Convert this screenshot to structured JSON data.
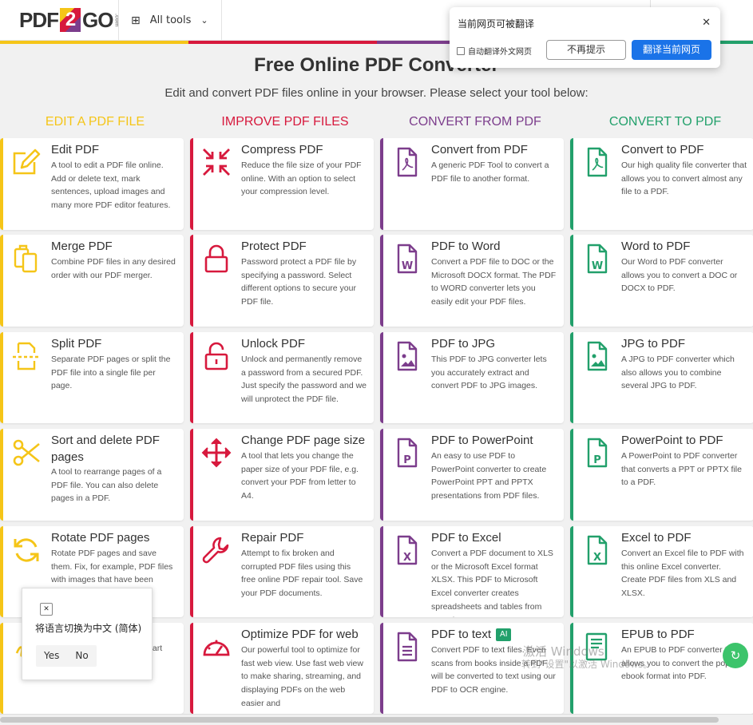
{
  "header": {
    "logo": {
      "pdf": "PDF",
      "two": "2",
      "go": "GO",
      "com": ".com"
    },
    "all_tools_label": "All tools"
  },
  "colors": {
    "edit": "#f5c518",
    "improve": "#d7193d",
    "convert_from": "#7c3d8c",
    "convert_to": "#22a06b"
  },
  "hero": {
    "title": "Free Online PDF Converter",
    "subtitle": "Edit and convert PDF files online in your browser. Please select your tool below:"
  },
  "columns": [
    {
      "heading": "EDIT A PDF FILE",
      "color": "#f5c518",
      "cards": [
        {
          "title": "Edit PDF",
          "icon": "pencil-square-icon",
          "desc": "A tool to edit a PDF file online. Add or delete text, mark sentences, upload images and many more PDF editor features."
        },
        {
          "title": "Merge PDF",
          "icon": "merge-documents-icon",
          "desc": "Combine PDF files in any desired order with our PDF merger."
        },
        {
          "title": "Split PDF",
          "icon": "split-page-icon",
          "desc": "Separate PDF pages or split the PDF file into a single file per page."
        },
        {
          "title": "Sort and delete PDF pages",
          "icon": "scissors-icon",
          "desc": "A tool to rearrange pages of a PDF file. You can also delete pages in a PDF."
        },
        {
          "title": "Rotate PDF pages",
          "icon": "rotate-arrows-icon",
          "desc": "Rotate PDF pages and save them. Fix, for example, PDF files with images that have been scanned upside down."
        },
        {
          "title": "",
          "icon": "sign-pdf-icon",
          "desc": "d start"
        }
      ]
    },
    {
      "heading": "IMPROVE PDF FILES",
      "color": "#d7193d",
      "cards": [
        {
          "title": "Compress PDF",
          "icon": "compress-arrows-icon",
          "desc": "Reduce the file size of your PDF online. With an option to select your compression level."
        },
        {
          "title": "Protect PDF",
          "icon": "lock-icon",
          "desc": "Password protect a PDF file by specifying a password. Select different options to secure your PDF file."
        },
        {
          "title": "Unlock PDF",
          "icon": "unlock-icon",
          "desc": "Unlock and permanently remove a password from a secured PDF. Just specify the password and we will unprotect the PDF file."
        },
        {
          "title": "Change PDF page size",
          "icon": "resize-arrows-icon",
          "desc": "A tool that lets you change the paper size of your PDF file, e.g. convert your PDF from letter to A4."
        },
        {
          "title": "Repair PDF",
          "icon": "wrench-icon",
          "desc": "Attempt to fix broken and corrupted PDF files using this free online PDF repair tool. Save your PDF documents."
        },
        {
          "title": "Optimize PDF for web",
          "icon": "speedometer-icon",
          "desc": "Our powerful tool to optimize for fast web view. Use fast web view to make sharing, streaming, and displaying PDFs on the web easier and"
        }
      ]
    },
    {
      "heading": "CONVERT FROM PDF",
      "color": "#7c3d8c",
      "cards": [
        {
          "title": "Convert from PDF",
          "icon": "pdf-file-icon",
          "desc": "A generic PDF Tool to convert a PDF file to another format."
        },
        {
          "title": "PDF to Word",
          "icon": "word-file-icon",
          "desc": "Convert a PDF file to DOC or the Microsoft DOCX format. The PDF to WORD converter lets you easily edit your PDF files."
        },
        {
          "title": "PDF to JPG",
          "icon": "image-file-icon",
          "desc": "This PDF to JPG converter lets you accurately extract and convert PDF to JPG images."
        },
        {
          "title": "PDF to PowerPoint",
          "icon": "powerpoint-file-icon",
          "desc": "An easy to use PDF to PowerPoint converter to create PowerPoint PPT and PPTX presentations from PDF files."
        },
        {
          "title": "PDF to Excel",
          "icon": "excel-file-icon",
          "desc": "Convert a PDF document to XLS or the Microsoft Excel format XLSX. This PDF to Microsoft Excel converter creates spreadsheets and tables from your documents."
        },
        {
          "title": "PDF to text",
          "icon": "text-file-icon",
          "badge": "AI",
          "desc": "Convert PDF to text files. Even scans from books inside a PDF will be converted to text using our PDF to OCR engine."
        }
      ]
    },
    {
      "heading": "CONVERT TO PDF",
      "color": "#22a06b",
      "cards": [
        {
          "title": "Convert to PDF",
          "icon": "pdf-file-icon",
          "desc": "Our high quality file converter that allows you to convert almost any file to a PDF."
        },
        {
          "title": "Word to PDF",
          "icon": "word-file-icon",
          "desc": "Our Word to PDF converter allows you to convert a DOC or DOCX to PDF."
        },
        {
          "title": "JPG to PDF",
          "icon": "image-file-icon",
          "desc": "A JPG to PDF converter which also allows you to combine several JPG to PDF."
        },
        {
          "title": "PowerPoint to PDF",
          "icon": "powerpoint-file-icon",
          "desc": "A PowerPoint to PDF converter that converts a PPT or PPTX file to a PDF."
        },
        {
          "title": "Excel to PDF",
          "icon": "excel-file-icon",
          "desc": "Convert an Excel file to PDF with this online Excel converter. Create PDF files from XLS and XLSX."
        },
        {
          "title": "EPUB to PDF",
          "icon": "ebook-file-icon",
          "desc": "An EPUB to PDF converter that allows you to convert the popular ebook format into PDF."
        }
      ]
    }
  ],
  "translate_popup": {
    "title": "当前网页可被翻译",
    "auto_label": "自动翻译外文网页",
    "dismiss_label": "不再提示",
    "translate_label": "翻译当前网页"
  },
  "language_popup": {
    "message": "将语言切换为中文 (简体)",
    "yes": "Yes",
    "no": "No"
  },
  "watermark": {
    "line1": "激活 Windows",
    "line2": "转到\"设置\"以激活 Windows。"
  }
}
